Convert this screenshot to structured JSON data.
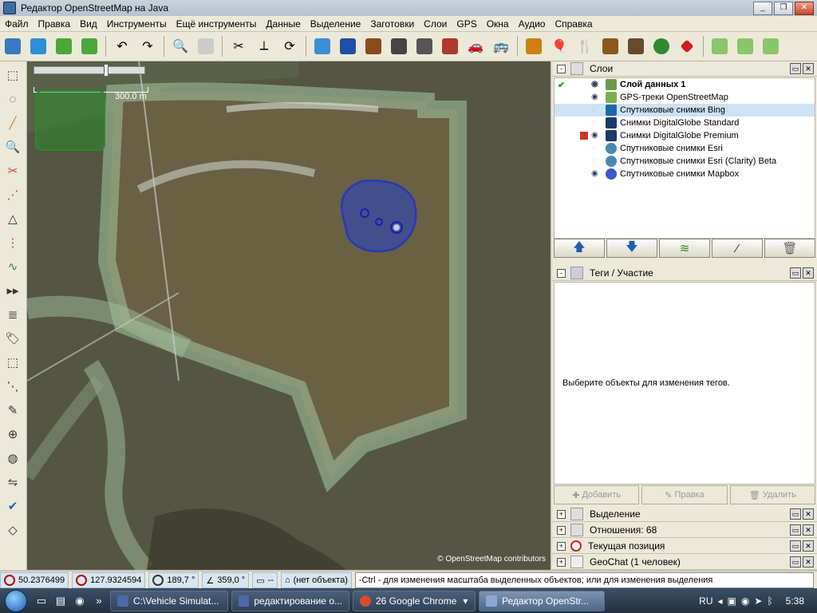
{
  "window": {
    "title": "Редактор OpenStreetMap на Java"
  },
  "menu": [
    "Файл",
    "Правка",
    "Вид",
    "Инструменты",
    "Ещё инструменты",
    "Данные",
    "Выделение",
    "Заготовки",
    "Слои",
    "GPS",
    "Окна",
    "Аудио",
    "Справка"
  ],
  "toolbar": {
    "icons": [
      "open-file-icon",
      "download-icon",
      "download-selection-icon",
      "upload-icon",
      "undo-icon",
      "redo-icon",
      "search-icon",
      "preferences-icon",
      "tools-icon",
      "split-icon",
      "combine-icon",
      "waterway-icon",
      "water-icon",
      "railway-icon",
      "road-icon",
      "rail-icon",
      "wall-icon",
      "car-icon",
      "bus-icon",
      "warning-icon",
      "poi-icon",
      "food-icon",
      "castle-icon",
      "industrial-icon",
      "tree-icon",
      "marker-icon",
      "download-green-icon",
      "upload-green-icon",
      "shrink-icon"
    ]
  },
  "lefttools": [
    "select-icon",
    "lasso-icon",
    "draw-icon",
    "zoom-icon",
    "delete-icon",
    "parallel-icon",
    "measure-icon",
    "extrude-icon",
    "improve-way-icon",
    "more-icon",
    "layer-list-icon",
    "tag-icon",
    "selection-icon",
    "relation-icon",
    "history-icon",
    "position-icon",
    "conflict-icon",
    "filter-icon",
    "validator-icon",
    "bug-icon"
  ],
  "map": {
    "scale_label": "300.0 m",
    "attribution": "© OpenStreetMap contributors"
  },
  "layers_panel": {
    "title": "Слои",
    "layers": [
      {
        "name": "Слой данных 1",
        "bold": true,
        "visible": true,
        "active": true
      },
      {
        "name": "GPS-треки OpenStreetMap",
        "visible": true
      },
      {
        "name": "Спутниковые снимки Bing",
        "visible": false,
        "selected": true
      },
      {
        "name": "Снимки DigitalGlobe Standard",
        "visible": false
      },
      {
        "name": "Снимки DigitalGlobe Premium",
        "visible": true
      },
      {
        "name": "Спутниковые снимки Esri",
        "visible": false
      },
      {
        "name": "Спутниковые снимки Esri (Clarity) Beta",
        "visible": false
      },
      {
        "name": "Спутниковые снимки Mapbox",
        "visible": true
      }
    ]
  },
  "tags_panel": {
    "title": "Теги / Участие",
    "message": "Выберите объекты для изменения тегов.",
    "add": "Добавить",
    "edit": "Правка",
    "delete": "Удалить"
  },
  "collapsed_panels": [
    "Выделение",
    "Отношения: 68",
    "Текущая позиция",
    "GeoChat (1 человек)"
  ],
  "status": {
    "lat": "50.2376499",
    "lon": "127.9324594",
    "heading": "189,7 °",
    "angle": "359,0 °",
    "distance": "--",
    "object": "(нет объекта)",
    "message": "-Ctrl - для изменения масштаба выделенных объектов; или для изменения выделения"
  },
  "taskbar": {
    "tasks": [
      {
        "label": "C:\\Vehicle Simulat..."
      },
      {
        "label": "редактирование о..."
      },
      {
        "label": "26 Google Chrome"
      },
      {
        "label": "Редактор OpenStr...",
        "active": true
      }
    ],
    "lang": "RU",
    "time": "5:38"
  }
}
